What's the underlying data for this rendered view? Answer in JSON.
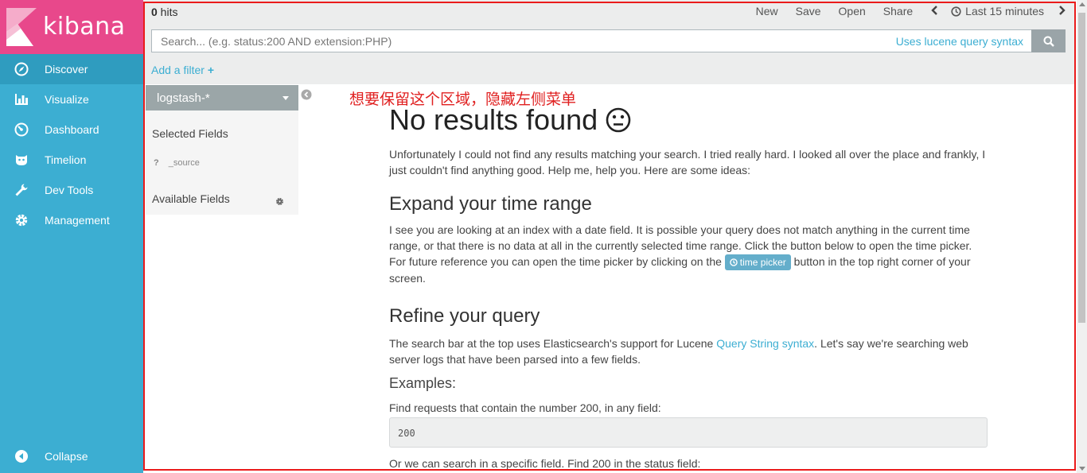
{
  "app": {
    "logo_text": "kibana"
  },
  "nav": {
    "items": [
      {
        "label": "Discover",
        "icon": "compass-icon",
        "active": true
      },
      {
        "label": "Visualize",
        "icon": "bar-chart-icon"
      },
      {
        "label": "Dashboard",
        "icon": "dashboard-icon"
      },
      {
        "label": "Timelion",
        "icon": "timelion-icon"
      },
      {
        "label": "Dev Tools",
        "icon": "wrench-icon"
      },
      {
        "label": "Management",
        "icon": "gear-icon"
      }
    ],
    "collapse_label": "Collapse"
  },
  "topbar": {
    "hits_count": "0",
    "hits_label": " hits",
    "menu": {
      "new": "New",
      "save": "Save",
      "open": "Open",
      "share": "Share"
    },
    "time_label": "Last 15 minutes",
    "search_placeholder": "Search... (e.g. status:200 AND extension:PHP)",
    "lucene_link": "Uses lucene query syntax",
    "add_filter": "Add a filter"
  },
  "sidebar": {
    "index_pattern": "logstash-*",
    "selected_fields_title": "Selected Fields",
    "source_field": {
      "type_icon": "?",
      "name": "_source"
    },
    "available_fields_title": "Available Fields"
  },
  "annotation": {
    "text": "想要保留这个区域，隐藏左侧菜单",
    "color": "#e02020"
  },
  "content": {
    "title": "No results found",
    "intro": "Unfortunately I could not find any results matching your search. I tried really hard. I looked all over the place and frankly, I just couldn't find anything good. Help me, help you. Here are some ideas:",
    "expand_title": "Expand your time range",
    "expand_text_before": "I see you are looking at an index with a date field. It is possible your query does not match anything in the current time range, or that there is no data at all in the currently selected time range. Click the button below to open the time picker. For future reference you can open the time picker by clicking on the ",
    "time_picker_badge": "time picker",
    "expand_text_after": " button in the top right corner of your screen.",
    "refine_title": "Refine your query",
    "refine_text_before": "The search bar at the top uses Elasticsearch's support for Lucene ",
    "refine_link": "Query String syntax",
    "refine_text_after": ". Let's say we're searching web server logs that have been parsed into a few fields.",
    "examples_title": "Examples:",
    "example1_text": "Find requests that contain the number 200, in any field:",
    "example1_code": "200",
    "example2_text": "Or we can search in a specific field. Find 200 in the status field:"
  },
  "colors": {
    "nav_bg": "#3caed2",
    "logo_bg": "#e8488b",
    "accent": "#3caed2",
    "annotation_frame": "#ea1b1b"
  }
}
